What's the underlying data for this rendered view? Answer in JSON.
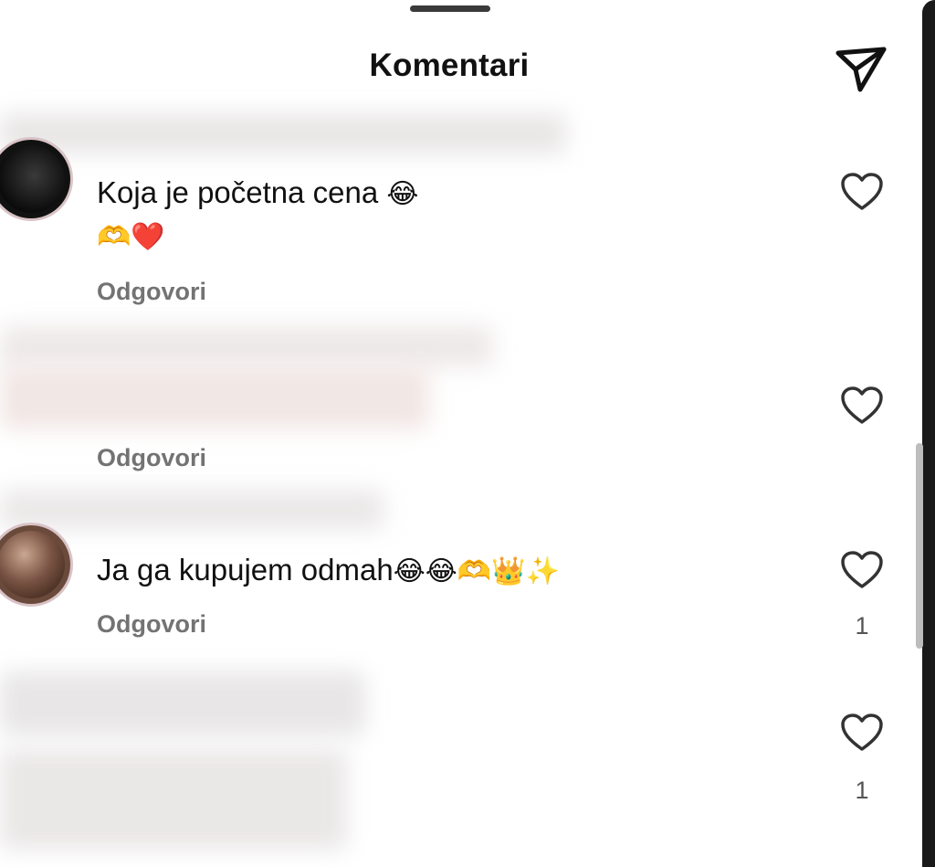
{
  "header": {
    "title": "Komentari",
    "send_icon": "paper-plane-icon"
  },
  "comments": [
    {
      "text": "Koja je početna cena",
      "emoji": "😂",
      "emoji_line": "🫶❤️",
      "reply_label": "Odgovori",
      "likes": ""
    },
    {
      "text": "",
      "emoji": "",
      "emoji_line": "",
      "reply_label": "Odgovori",
      "likes": ""
    },
    {
      "text": "Ja ga kupujem odmah",
      "emoji": "😂😂🫶👑✨",
      "emoji_line": "",
      "reply_label": "Odgovori",
      "likes": "1"
    },
    {
      "text": "",
      "emoji": "",
      "emoji_line": "",
      "reply_label": "",
      "likes": "1"
    }
  ],
  "colors": {
    "background": "#ffffff",
    "text": "#111111",
    "secondary": "#737373",
    "heart_red": "#e0263a"
  }
}
